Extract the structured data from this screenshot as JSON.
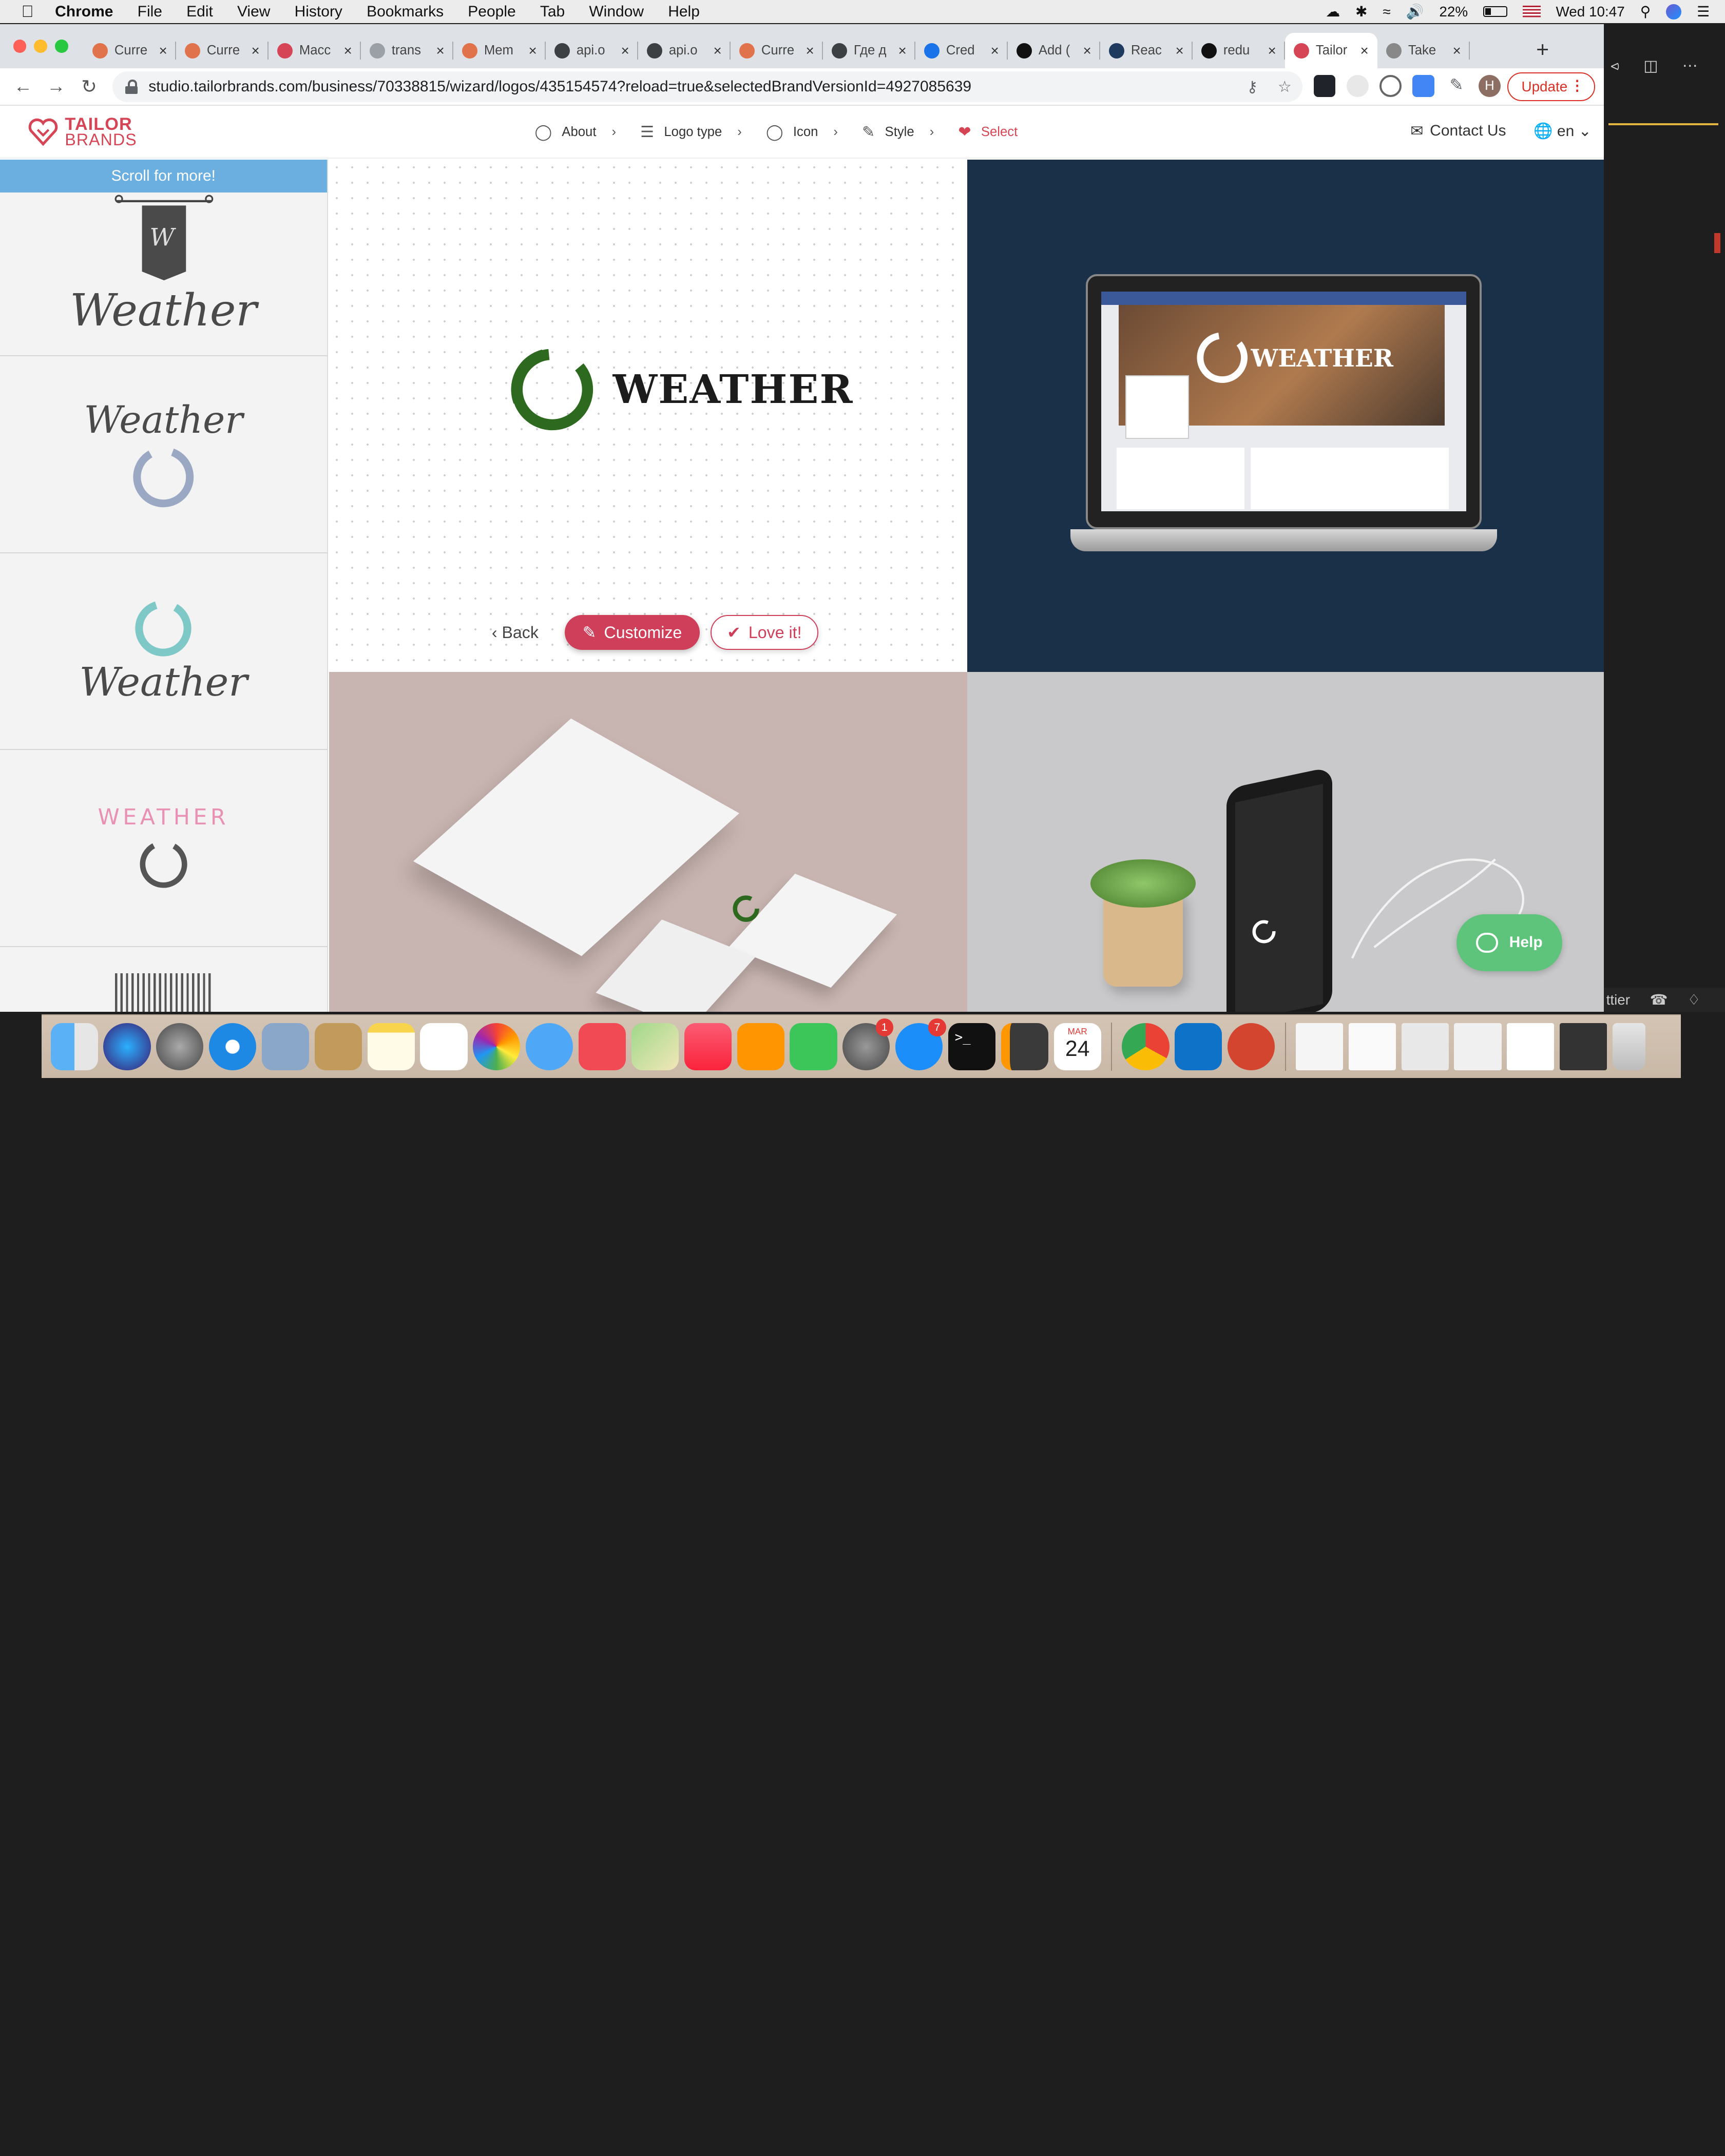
{
  "menubar": {
    "app": "Chrome",
    "items": [
      "File",
      "Edit",
      "View",
      "History",
      "Bookmarks",
      "People",
      "Tab",
      "Window",
      "Help"
    ],
    "battery": "22%",
    "clock": "Wed 10:47"
  },
  "browser": {
    "tabs": [
      {
        "label": "Curre",
        "color": "#e0734c"
      },
      {
        "label": "Curre",
        "color": "#e0734c"
      },
      {
        "label": "Macc",
        "color": "#d64556"
      },
      {
        "label": "trans",
        "color": "#9aa0a6"
      },
      {
        "label": "Mem",
        "color": "#e0734c"
      },
      {
        "label": "api.o",
        "color": "#3c4043"
      },
      {
        "label": "api.o",
        "color": "#3c4043"
      },
      {
        "label": "Curre",
        "color": "#e0734c"
      },
      {
        "label": "Где д",
        "color": "#3c4043"
      },
      {
        "label": "Cred",
        "color": "#1a73e8"
      },
      {
        "label": "Add (",
        "color": "#111"
      },
      {
        "label": "Reac",
        "color": "#1e3a5f"
      },
      {
        "label": "redu",
        "color": "#111"
      },
      {
        "label": "Tailor",
        "color": "#d64556",
        "active": true
      },
      {
        "label": "Take",
        "color": "#888"
      }
    ],
    "url": "studio.tailorbrands.com/business/70338815/wizard/logos/435154574?reload=true&selectedBrandVersionId=4927085639",
    "update_label": "Update",
    "profile_initial": "H"
  },
  "site": {
    "brand_line1": "TAILOR",
    "brand_line2": "BRANDS",
    "steps": [
      "About",
      "Logo type",
      "Icon",
      "Style",
      "Select"
    ],
    "contact": "Contact Us",
    "lang": "en"
  },
  "sidebar": {
    "scroll_hint": "Scroll for more!",
    "logos": [
      {
        "text": "Weather",
        "ribbon": "W"
      },
      {
        "text": "Weather"
      },
      {
        "text": "Weather"
      },
      {
        "text": "WEATHER"
      }
    ]
  },
  "main": {
    "logo_text": "WEATHER",
    "back_label": "Back",
    "customize_label": "Customize",
    "love_label": "Love it!",
    "help_label": "Help",
    "brand_color": "#2d6a1f",
    "accent": "#cf3f5a"
  },
  "editor": {
    "status_text": "ttier"
  },
  "dock": {
    "badges": {
      "settings": "1",
      "appstore": "7"
    },
    "calendar_month": "MAR",
    "calendar_day": "24"
  }
}
